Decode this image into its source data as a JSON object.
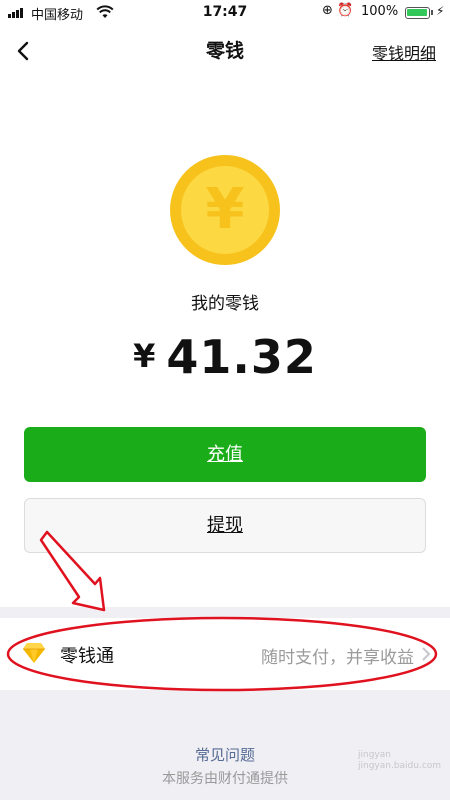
{
  "status_bar": {
    "carrier": "中国移动",
    "time": "17:47",
    "battery_percent": "100%",
    "battery_level": 1.0
  },
  "nav": {
    "title": "零钱",
    "detail_link": "零钱明细",
    "back_icon": "chevron-left-icon"
  },
  "wallet": {
    "coin_symbol": "¥",
    "balance_label": "我的零钱",
    "currency": "¥",
    "amount": "41.32"
  },
  "actions": {
    "recharge_label": "充值",
    "withdraw_label": "提现"
  },
  "lingqiantong": {
    "title": "零钱通",
    "description": "随时支付，并享收益",
    "icon": "diamond-icon"
  },
  "footer": {
    "faq_link": "常见问题",
    "provider_text": "本服务由财付通提供"
  },
  "watermark": {
    "line1": "jingyan",
    "line2": "jingyan.baidu.com"
  },
  "colors": {
    "primary_green": "#1aad19",
    "coin_yellow": "#f7c21c",
    "annotation_red": "#e0121f",
    "link_blue": "#576b95"
  }
}
